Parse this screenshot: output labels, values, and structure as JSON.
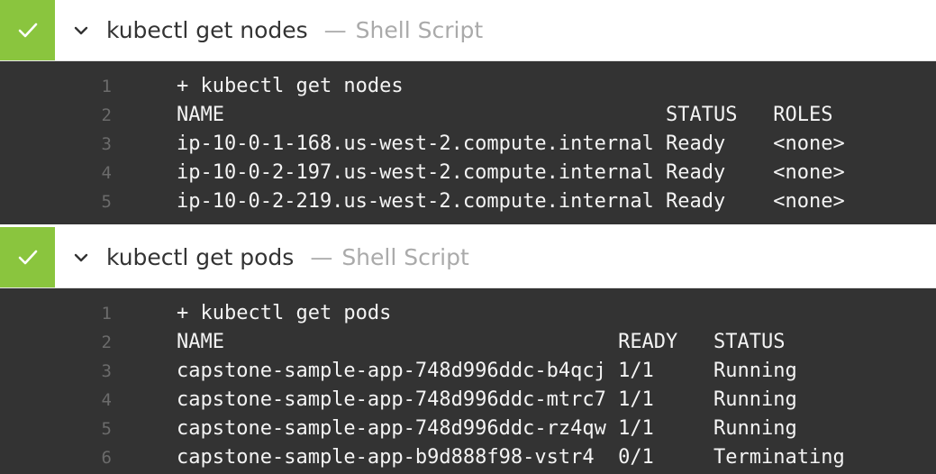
{
  "steps": [
    {
      "title": "kubectl get nodes",
      "separator": "—",
      "type": "Shell Script",
      "status": "success",
      "lines": [
        {
          "n": "1",
          "text": "+ kubectl get nodes"
        },
        {
          "n": "2",
          "text": "NAME                                     STATUS   ROLES"
        },
        {
          "n": "3",
          "text": "ip-10-0-1-168.us-west-2.compute.internal Ready    <none>"
        },
        {
          "n": "4",
          "text": "ip-10-0-2-197.us-west-2.compute.internal Ready    <none>"
        },
        {
          "n": "5",
          "text": "ip-10-0-2-219.us-west-2.compute.internal Ready    <none>"
        }
      ]
    },
    {
      "title": "kubectl get pods",
      "separator": "—",
      "type": "Shell Script",
      "status": "success",
      "lines": [
        {
          "n": "1",
          "text": "+ kubectl get pods"
        },
        {
          "n": "2",
          "text": "NAME                                 READY   STATUS"
        },
        {
          "n": "3",
          "text": "capstone-sample-app-748d996ddc-b4qcj 1/1     Running"
        },
        {
          "n": "4",
          "text": "capstone-sample-app-748d996ddc-mtrc7 1/1     Running"
        },
        {
          "n": "5",
          "text": "capstone-sample-app-748d996ddc-rz4qw 1/1     Running"
        },
        {
          "n": "6",
          "text": "capstone-sample-app-b9d888f98-vstr4  0/1     Terminating"
        }
      ]
    }
  ],
  "colors": {
    "success": "#8ac53e",
    "console_bg": "#333333"
  },
  "icons": {
    "status": "checkmark-icon",
    "toggle": "chevron-down-icon"
  }
}
